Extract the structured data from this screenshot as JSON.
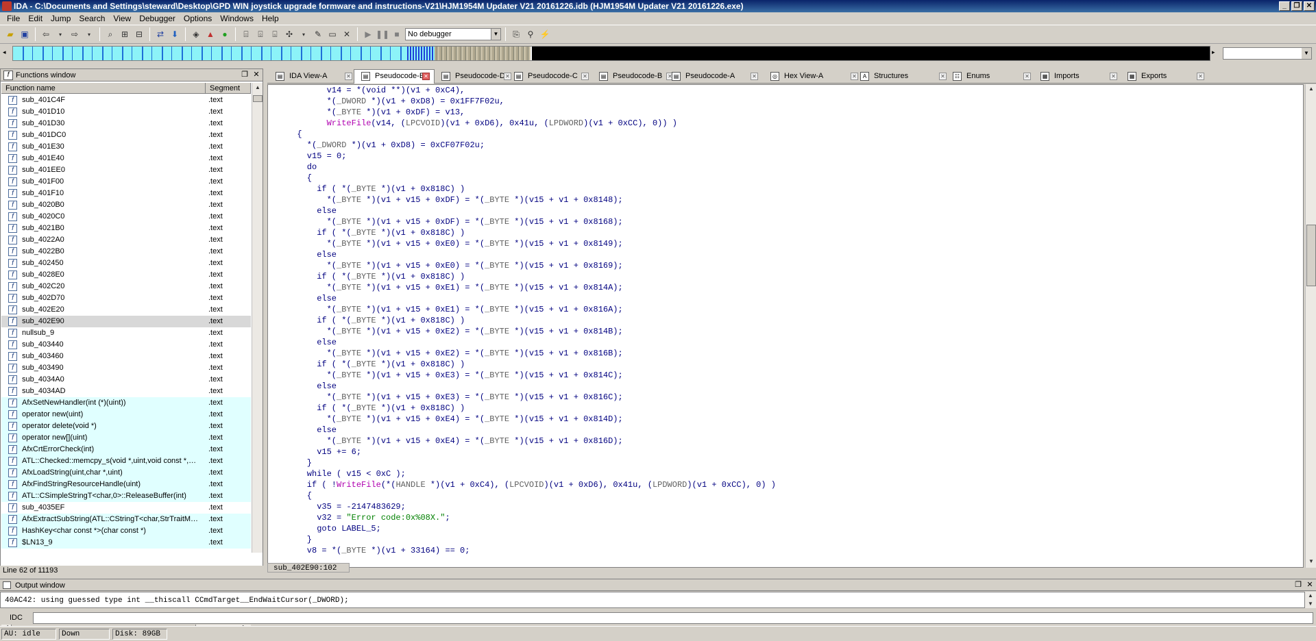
{
  "window": {
    "title": "IDA - C:\\Documents and Settings\\steward\\Desktop\\GPD  WIN joystick upgrade formware and instructions-V21\\HJM1954M Updater V21 20161226.idb (HJM1954M Updater V21 20161226.exe)",
    "controls": [
      "_",
      "❐",
      "✕"
    ]
  },
  "menu": [
    "File",
    "Edit",
    "Jump",
    "Search",
    "View",
    "Debugger",
    "Options",
    "Windows",
    "Help"
  ],
  "toolbar": {
    "debugger_select": "No debugger"
  },
  "functions_window": {
    "title": "Functions window",
    "col_name": "Function name",
    "col_segment": "Segment",
    "rows": [
      {
        "name": "sub_401C4F",
        "seg": ".text",
        "lib": false
      },
      {
        "name": "sub_401D10",
        "seg": ".text",
        "lib": false
      },
      {
        "name": "sub_401D30",
        "seg": ".text",
        "lib": false
      },
      {
        "name": "sub_401DC0",
        "seg": ".text",
        "lib": false
      },
      {
        "name": "sub_401E30",
        "seg": ".text",
        "lib": false
      },
      {
        "name": "sub_401E40",
        "seg": ".text",
        "lib": false
      },
      {
        "name": "sub_401EE0",
        "seg": ".text",
        "lib": false
      },
      {
        "name": "sub_401F00",
        "seg": ".text",
        "lib": false
      },
      {
        "name": "sub_401F10",
        "seg": ".text",
        "lib": false
      },
      {
        "name": "sub_4020B0",
        "seg": ".text",
        "lib": false
      },
      {
        "name": "sub_4020C0",
        "seg": ".text",
        "lib": false
      },
      {
        "name": "sub_4021B0",
        "seg": ".text",
        "lib": false
      },
      {
        "name": "sub_4022A0",
        "seg": ".text",
        "lib": false
      },
      {
        "name": "sub_4022B0",
        "seg": ".text",
        "lib": false
      },
      {
        "name": "sub_402450",
        "seg": ".text",
        "lib": false
      },
      {
        "name": "sub_4028E0",
        "seg": ".text",
        "lib": false
      },
      {
        "name": "sub_402C20",
        "seg": ".text",
        "lib": false
      },
      {
        "name": "sub_402D70",
        "seg": ".text",
        "lib": false
      },
      {
        "name": "sub_402E20",
        "seg": ".text",
        "lib": false
      },
      {
        "name": "sub_402E90",
        "seg": ".text",
        "lib": false,
        "selected": true
      },
      {
        "name": "nullsub_9",
        "seg": ".text",
        "lib": false
      },
      {
        "name": "sub_403440",
        "seg": ".text",
        "lib": false
      },
      {
        "name": "sub_403460",
        "seg": ".text",
        "lib": false
      },
      {
        "name": "sub_403490",
        "seg": ".text",
        "lib": false
      },
      {
        "name": "sub_4034A0",
        "seg": ".text",
        "lib": false
      },
      {
        "name": "sub_4034AD",
        "seg": ".text",
        "lib": false
      },
      {
        "name": "AfxSetNewHandler(int (*)(uint))",
        "seg": ".text",
        "lib": true
      },
      {
        "name": "operator new(uint)",
        "seg": ".text",
        "lib": true
      },
      {
        "name": "operator delete(void *)",
        "seg": ".text",
        "lib": true
      },
      {
        "name": "operator new[](uint)",
        "seg": ".text",
        "lib": true
      },
      {
        "name": "AfxCrtErrorCheck(int)",
        "seg": ".text",
        "lib": true
      },
      {
        "name": "ATL::Checked::memcpy_s(void *,uint,void const *,ui...",
        "seg": ".text",
        "lib": true
      },
      {
        "name": "AfxLoadString(uint,char *,uint)",
        "seg": ".text",
        "lib": true
      },
      {
        "name": "AfxFindStringResourceHandle(uint)",
        "seg": ".text",
        "lib": true
      },
      {
        "name": "ATL::CSimpleStringT<char,0>::ReleaseBuffer(int)",
        "seg": ".text",
        "lib": true
      },
      {
        "name": "sub_4035EF",
        "seg": ".text",
        "lib": false
      },
      {
        "name": "AfxExtractSubString(ATL::CStringT<char,StrTraitMF...",
        "seg": ".text",
        "lib": true
      },
      {
        "name": "HashKey<char const *>(char const *)",
        "seg": ".text",
        "lib": true
      },
      {
        "name": "$LN13_9",
        "seg": ".text",
        "lib": true
      }
    ],
    "status": "Line 62 of 11193"
  },
  "tabs": [
    {
      "label": "IDA View-A",
      "active": false
    },
    {
      "label": "Pseudocode-E",
      "active": true
    },
    {
      "label": "Pseudocode-D",
      "active": false
    },
    {
      "label": "Pseudocode-C",
      "active": false
    },
    {
      "label": "Pseudocode-B",
      "active": false
    },
    {
      "label": "Pseudocode-A",
      "active": false
    },
    {
      "label": "Hex View-A",
      "active": false
    },
    {
      "label": "Structures",
      "active": false
    },
    {
      "label": "Enums",
      "active": false
    },
    {
      "label": "Imports",
      "active": false
    },
    {
      "label": "Exports",
      "active": false
    }
  ],
  "code_lines": [
    "        v14 = *(void **)(v1 + 0xC4),",
    "        *(_DWORD *)(v1 + 0xD8) = 0x1FF7F02u,",
    "        *(_BYTE *)(v1 + 0xDF) = v13,",
    "        WriteFile(v14, (LPCVOID)(v1 + 0xD6), 0x41u, (LPDWORD)(v1 + 0xCC), 0)) )",
    "  {",
    "    *(_DWORD *)(v1 + 0xD8) = 0xCF07F02u;",
    "    v15 = 0;",
    "    do",
    "    {",
    "      if ( *(_BYTE *)(v1 + 0x818C) )",
    "        *(_BYTE *)(v1 + v15 + 0xDF) = *(_BYTE *)(v15 + v1 + 0x8148);",
    "      else",
    "        *(_BYTE *)(v1 + v15 + 0xDF) = *(_BYTE *)(v15 + v1 + 0x8168);",
    "      if ( *(_BYTE *)(v1 + 0x818C) )",
    "        *(_BYTE *)(v1 + v15 + 0xE0) = *(_BYTE *)(v15 + v1 + 0x8149);",
    "      else",
    "        *(_BYTE *)(v1 + v15 + 0xE0) = *(_BYTE *)(v15 + v1 + 0x8169);",
    "      if ( *(_BYTE *)(v1 + 0x818C) )",
    "        *(_BYTE *)(v1 + v15 + 0xE1) = *(_BYTE *)(v15 + v1 + 0x814A);",
    "      else",
    "        *(_BYTE *)(v1 + v15 + 0xE1) = *(_BYTE *)(v15 + v1 + 0x816A);",
    "      if ( *(_BYTE *)(v1 + 0x818C) )",
    "        *(_BYTE *)(v1 + v15 + 0xE2) = *(_BYTE *)(v15 + v1 + 0x814B);",
    "      else",
    "        *(_BYTE *)(v1 + v15 + 0xE2) = *(_BYTE *)(v15 + v1 + 0x816B);",
    "      if ( *(_BYTE *)(v1 + 0x818C) )",
    "        *(_BYTE *)(v1 + v15 + 0xE3) = *(_BYTE *)(v15 + v1 + 0x814C);",
    "      else",
    "        *(_BYTE *)(v1 + v15 + 0xE3) = *(_BYTE *)(v15 + v1 + 0x816C);",
    "      if ( *(_BYTE *)(v1 + 0x818C) )",
    "        *(_BYTE *)(v1 + v15 + 0xE4) = *(_BYTE *)(v15 + v1 + 0x814D);",
    "      else",
    "        *(_BYTE *)(v1 + v15 + 0xE4) = *(_BYTE *)(v15 + v1 + 0x816D);",
    "      v15 += 6;",
    "    }",
    "    while ( v15 < 0xC );",
    "    if ( !WriteFile(*(HANDLE *)(v1 + 0xC4), (LPCVOID)(v1 + 0xD6), 0x41u, (LPDWORD)(v1 + 0xCC), 0) )",
    "    {",
    "      v35 = -2147483629;",
    "      v32 = \"Error code:0x%08X.\";",
    "      goto LABEL_5;",
    "    }",
    "    v8 = *(_BYTE *)(v1 + 33164) == 0;"
  ],
  "code_status": "sub_402E90:102",
  "output_window": {
    "title": "Output window",
    "text": "40AC42: using guessed type int __thiscall CCmdTarget__EndWaitCursor(_DWORD);",
    "idc_label": "IDC"
  },
  "statusbar": [
    "AU:  idle",
    "Down",
    "Disk: 89GB"
  ],
  "colors": {
    "title_bg": "#0a246a",
    "lib_row": "#e0ffff",
    "code_text": "#000080",
    "api_call": "#b000b0",
    "string": "#008000"
  }
}
